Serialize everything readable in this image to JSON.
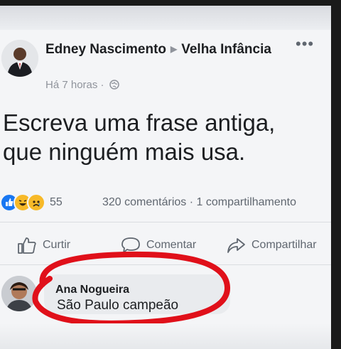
{
  "post": {
    "author": "Edney Nascimento",
    "group": "Velha Infância",
    "time": "Há 7 horas",
    "privacy_icon": "globe-icon",
    "text_line1": "Escreva uma frase antiga,",
    "text_line2": "que ninguém mais usa."
  },
  "stats": {
    "reaction_icons": [
      "like-reaction-icon",
      "haha-reaction-icon",
      "sad-reaction-icon"
    ],
    "reaction_count": "55",
    "comments_shares": "320 comentários · 1 compartilhamento"
  },
  "actions": {
    "like": "Curtir",
    "comment": "Comentar",
    "share": "Compartilhar"
  },
  "comment": {
    "author": "Ana Nogueira",
    "text": "São Paulo campeão"
  },
  "colors": {
    "text": "#1c1e21",
    "muted": "#606770",
    "like_blue": "#1877f2",
    "reaction_yellow": "#f7b928",
    "highlight_red": "#e0101a"
  }
}
